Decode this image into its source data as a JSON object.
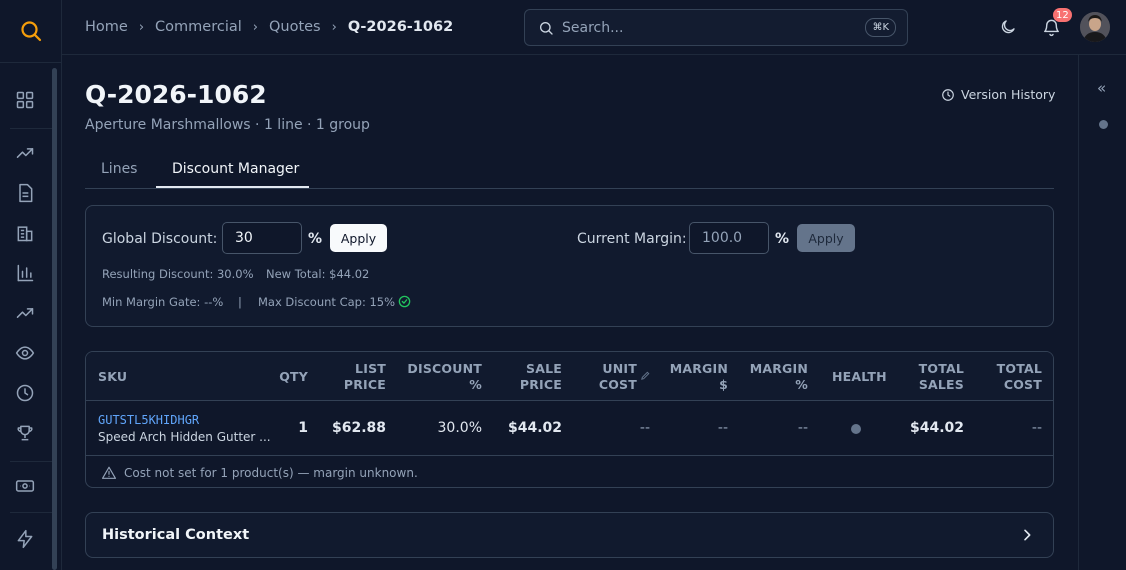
{
  "breadcrumb": [
    "Home",
    "Commercial",
    "Quotes",
    "Q-2026-1062"
  ],
  "search": {
    "placeholder": "Search...",
    "shortcut": "⌘K"
  },
  "notifications": {
    "count": "12"
  },
  "quote": {
    "title": "Q-2026-1062",
    "subtitle": "Aperture Marshmallows · 1 line · 1 group",
    "version_history": "Version History"
  },
  "tabs": [
    {
      "label": "Lines",
      "active": false
    },
    {
      "label": "Discount Manager",
      "active": true
    }
  ],
  "discount": {
    "global_label": "Global Discount:",
    "global_value": "30",
    "pct": "%",
    "apply": "Apply",
    "margin_label": "Current Margin:",
    "margin_value": "100.0",
    "resulting": "Resulting Discount: 30.0%",
    "new_total": "New Total: $44.02",
    "min_margin": "Min Margin Gate: --%",
    "separator": "|",
    "max_cap": "Max Discount Cap: 15%"
  },
  "table": {
    "headers": {
      "sku": "SKU",
      "qty": "QTY",
      "list_price": [
        "LIST",
        "PRICE"
      ],
      "discount": [
        "DISCOUNT",
        "%"
      ],
      "sale_price": [
        "SALE",
        "PRICE"
      ],
      "unit_cost": [
        "UNIT",
        "COST"
      ],
      "margin_d": [
        "MARGIN",
        "$"
      ],
      "margin_p": [
        "MARGIN",
        "%"
      ],
      "health": "HEALTH",
      "total_sales": [
        "TOTAL",
        "SALES"
      ],
      "total_cost": [
        "TOTAL",
        "COST"
      ]
    },
    "rows": [
      {
        "sku": "GUTSTL5KHIDHGR",
        "name": "Speed Arch Hidden Gutter ...",
        "qty": "1",
        "list_price": "$62.88",
        "discount": "30.0%",
        "sale_price": "$44.02",
        "unit_cost": "--",
        "margin_d": "--",
        "margin_p": "--",
        "total_sales": "$44.02",
        "total_cost": "--"
      }
    ],
    "warning": "Cost not set for 1 product(s) — margin unknown."
  },
  "historical": {
    "title": "Historical Context"
  },
  "colors": {
    "background": "#0f172a",
    "accent_logo": "#f59e0b",
    "sku_link": "#60a5fa",
    "success": "#22c55e",
    "badge": "#f87171"
  }
}
